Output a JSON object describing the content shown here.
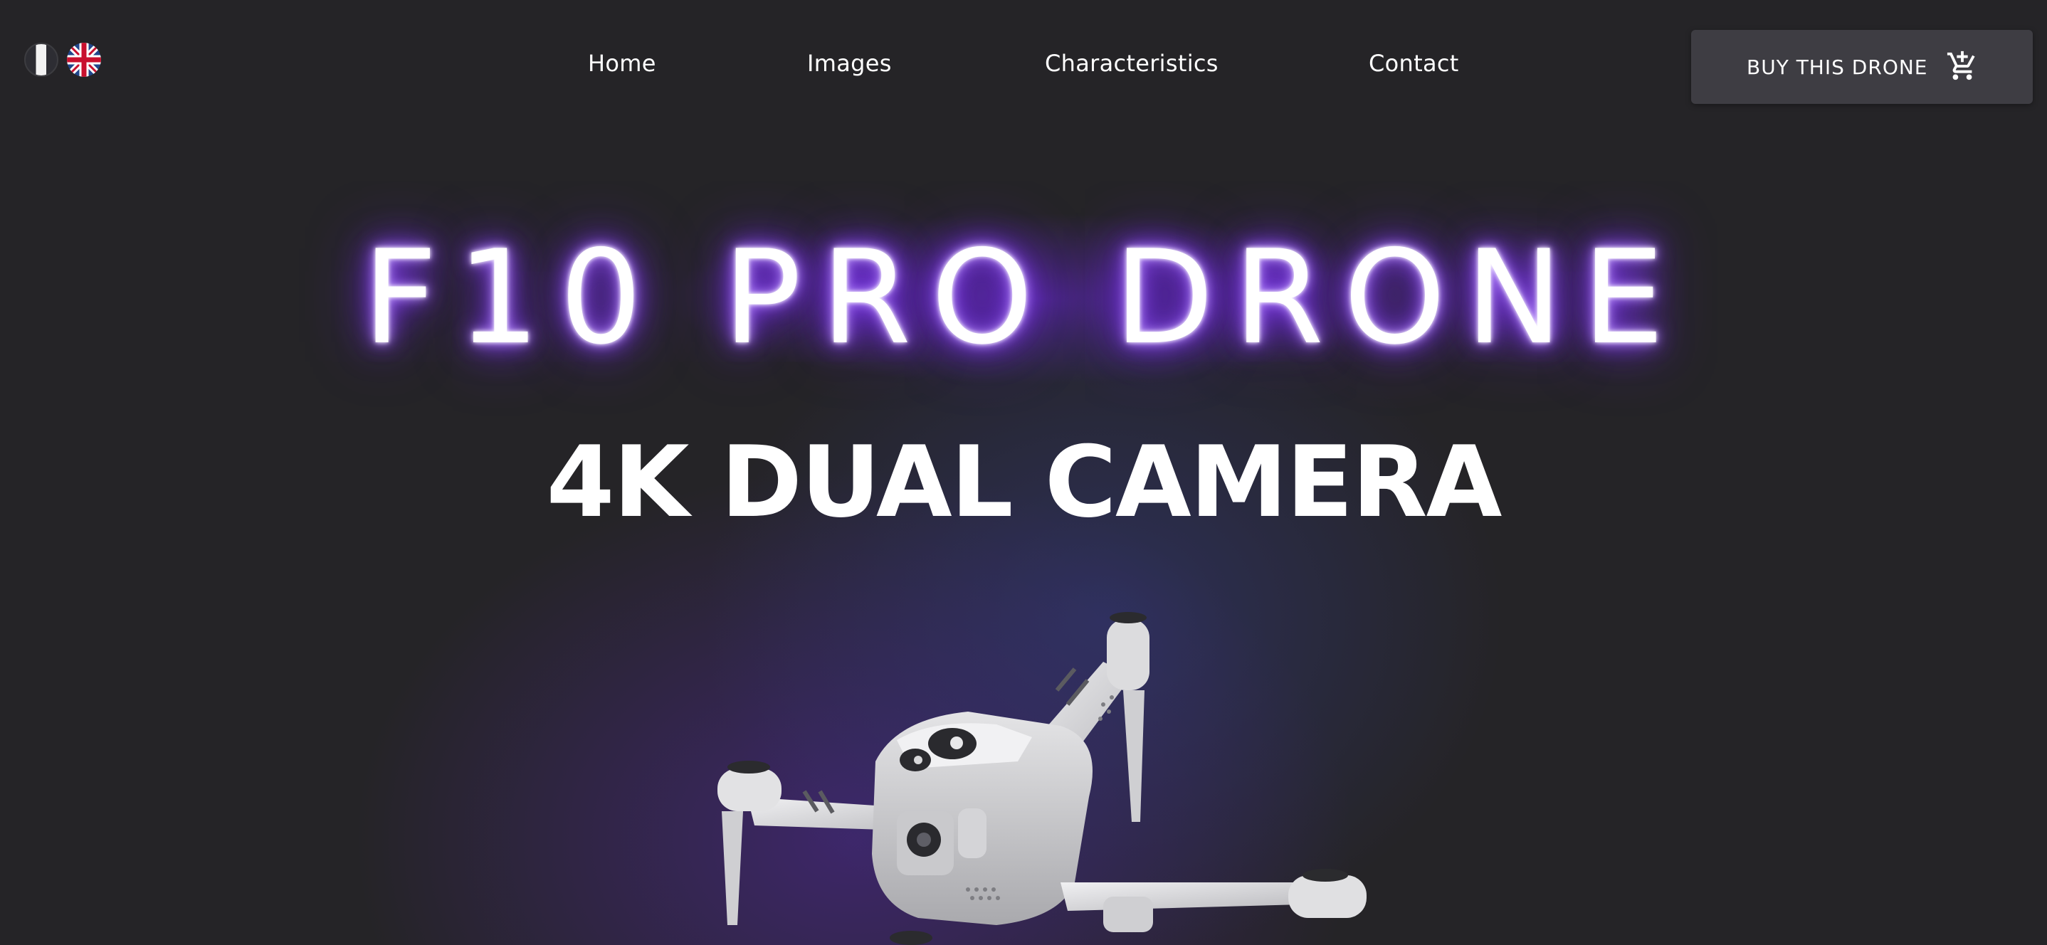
{
  "languages": [
    {
      "code": "fr",
      "icon": "france-flag-icon"
    },
    {
      "code": "en",
      "icon": "uk-flag-icon"
    }
  ],
  "nav": {
    "items": [
      {
        "label": "Home"
      },
      {
        "label": "Images"
      },
      {
        "label": "Characteristics"
      },
      {
        "label": "Contact"
      }
    ]
  },
  "buy_button": {
    "label": "BUY THIS DRONE",
    "icon": "add-to-cart-icon"
  },
  "hero": {
    "title": "F10 PRO DRONE",
    "subtitle": "4K DUAL CAMERA",
    "image_icon": "drone-image"
  },
  "colors": {
    "background": "#252427",
    "button_bg": "#3e3d43",
    "neon_glow": "#7a2cff",
    "text": "#ffffff"
  }
}
